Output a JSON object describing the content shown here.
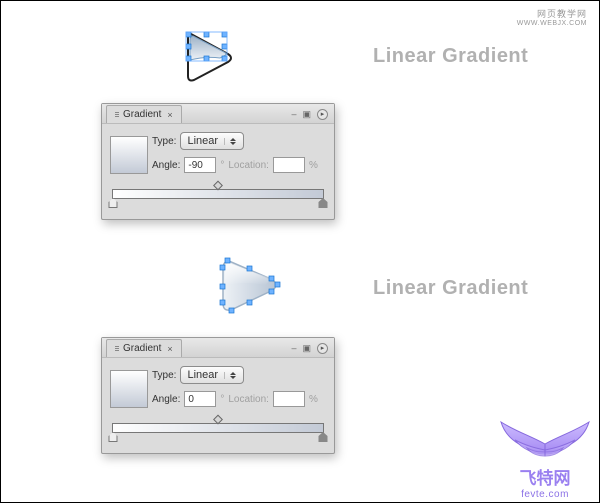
{
  "watermark": {
    "line1": "网页教学网",
    "line2": "WWW.WEBJX.COM"
  },
  "labels": {
    "top": "Linear Gradient",
    "bottom": "Linear Gradient"
  },
  "panel1": {
    "tab_label": "Gradient",
    "type_label": "Type:",
    "type_value": "Linear",
    "angle_label": "Angle:",
    "angle_value": "-90",
    "angle_deg": "°",
    "location_label": "Location:",
    "location_value": "",
    "location_suffix": "%",
    "swatch_gradient": {
      "from": "#ffffff",
      "to": "#c3cad6",
      "angle": "180deg"
    }
  },
  "panel2": {
    "tab_label": "Gradient",
    "type_label": "Type:",
    "type_value": "Linear",
    "angle_label": "Angle:",
    "angle_value": "0",
    "angle_deg": "°",
    "location_label": "Location:",
    "location_value": "",
    "location_suffix": "%",
    "swatch_gradient": {
      "from": "#ffffff",
      "to": "#c3cad6",
      "angle": "180deg"
    }
  },
  "logo": {
    "brand": "飞特网",
    "url": "fevte.com"
  }
}
